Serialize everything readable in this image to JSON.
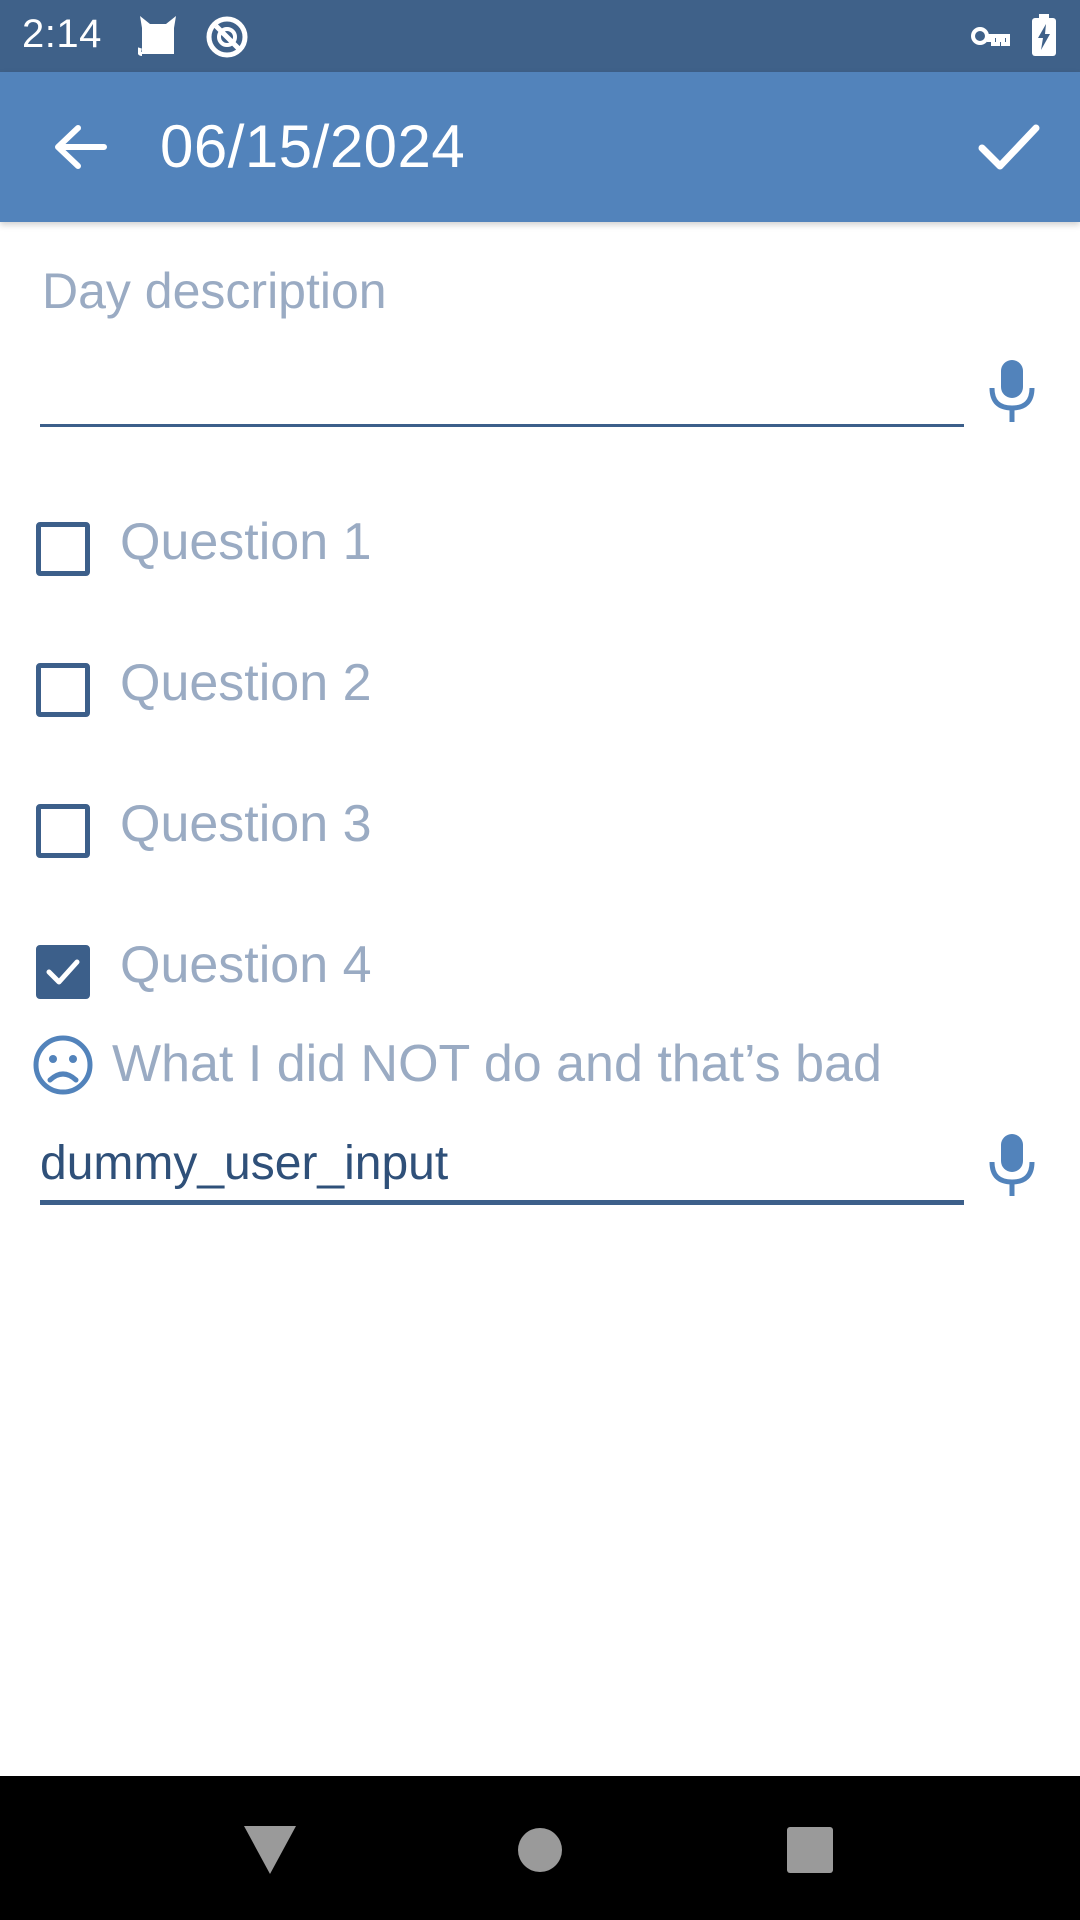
{
  "status_bar": {
    "time": "2:14",
    "icons": [
      "cat-notification-icon",
      "no-sync-icon",
      "vpn-key-icon",
      "battery-charging-icon"
    ]
  },
  "app_bar": {
    "title": "06/15/2024",
    "back_icon": "arrow-back-icon",
    "confirm_icon": "check-icon"
  },
  "day_description": {
    "label": "Day description",
    "value": "",
    "mic_icon": "mic-icon"
  },
  "questions": [
    {
      "label": "Question 1",
      "checked": false
    },
    {
      "label": "Question 2",
      "checked": false
    },
    {
      "label": "Question 3",
      "checked": false
    },
    {
      "label": "Question 4",
      "checked": true
    }
  ],
  "bad_section": {
    "icon": "sad-face-icon",
    "label": "What I did NOT do and that’s bad",
    "value": "dummy_user_input",
    "mic_icon": "mic-icon"
  },
  "nav_bar": {
    "buttons": [
      "back-triangle-icon",
      "home-circle-icon",
      "recents-square-icon"
    ]
  },
  "colors": {
    "status_bar": "#3f6189",
    "app_bar": "#5283bb",
    "accent": "#3c5f8a",
    "faded_text": "#9aabc3",
    "nav_bar": "#000000"
  }
}
